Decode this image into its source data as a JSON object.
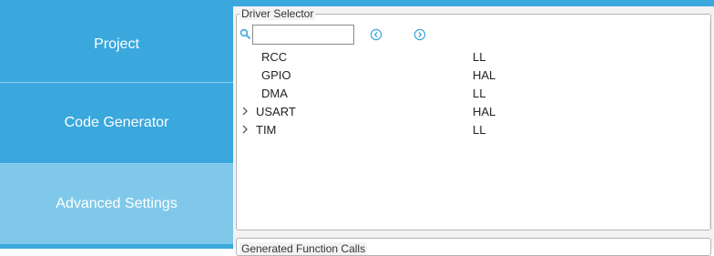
{
  "sidebar": {
    "tabs": [
      {
        "label": "Project"
      },
      {
        "label": "Code Generator"
      },
      {
        "label": "Advanced Settings"
      }
    ]
  },
  "driver_selector": {
    "title": "Driver Selector",
    "search": {
      "value": "",
      "placeholder": ""
    },
    "icons": {
      "search": "search-icon",
      "prev": "chevron-left-circle-icon",
      "next": "chevron-right-circle-icon"
    },
    "rows": [
      {
        "name": "RCC",
        "driver": "LL",
        "expandable": false
      },
      {
        "name": "GPIO",
        "driver": "HAL",
        "expandable": false
      },
      {
        "name": "DMA",
        "driver": "LL",
        "expandable": false
      },
      {
        "name": "USART",
        "driver": "HAL",
        "expandable": true
      },
      {
        "name": "TIM",
        "driver": "LL",
        "expandable": true
      }
    ]
  },
  "generated_calls": {
    "title": "Generated Function Calls"
  },
  "colors": {
    "accent": "#3aa8dd",
    "selected_tab": "#7fc8ea",
    "nav_icon": "#3aa8dd"
  }
}
